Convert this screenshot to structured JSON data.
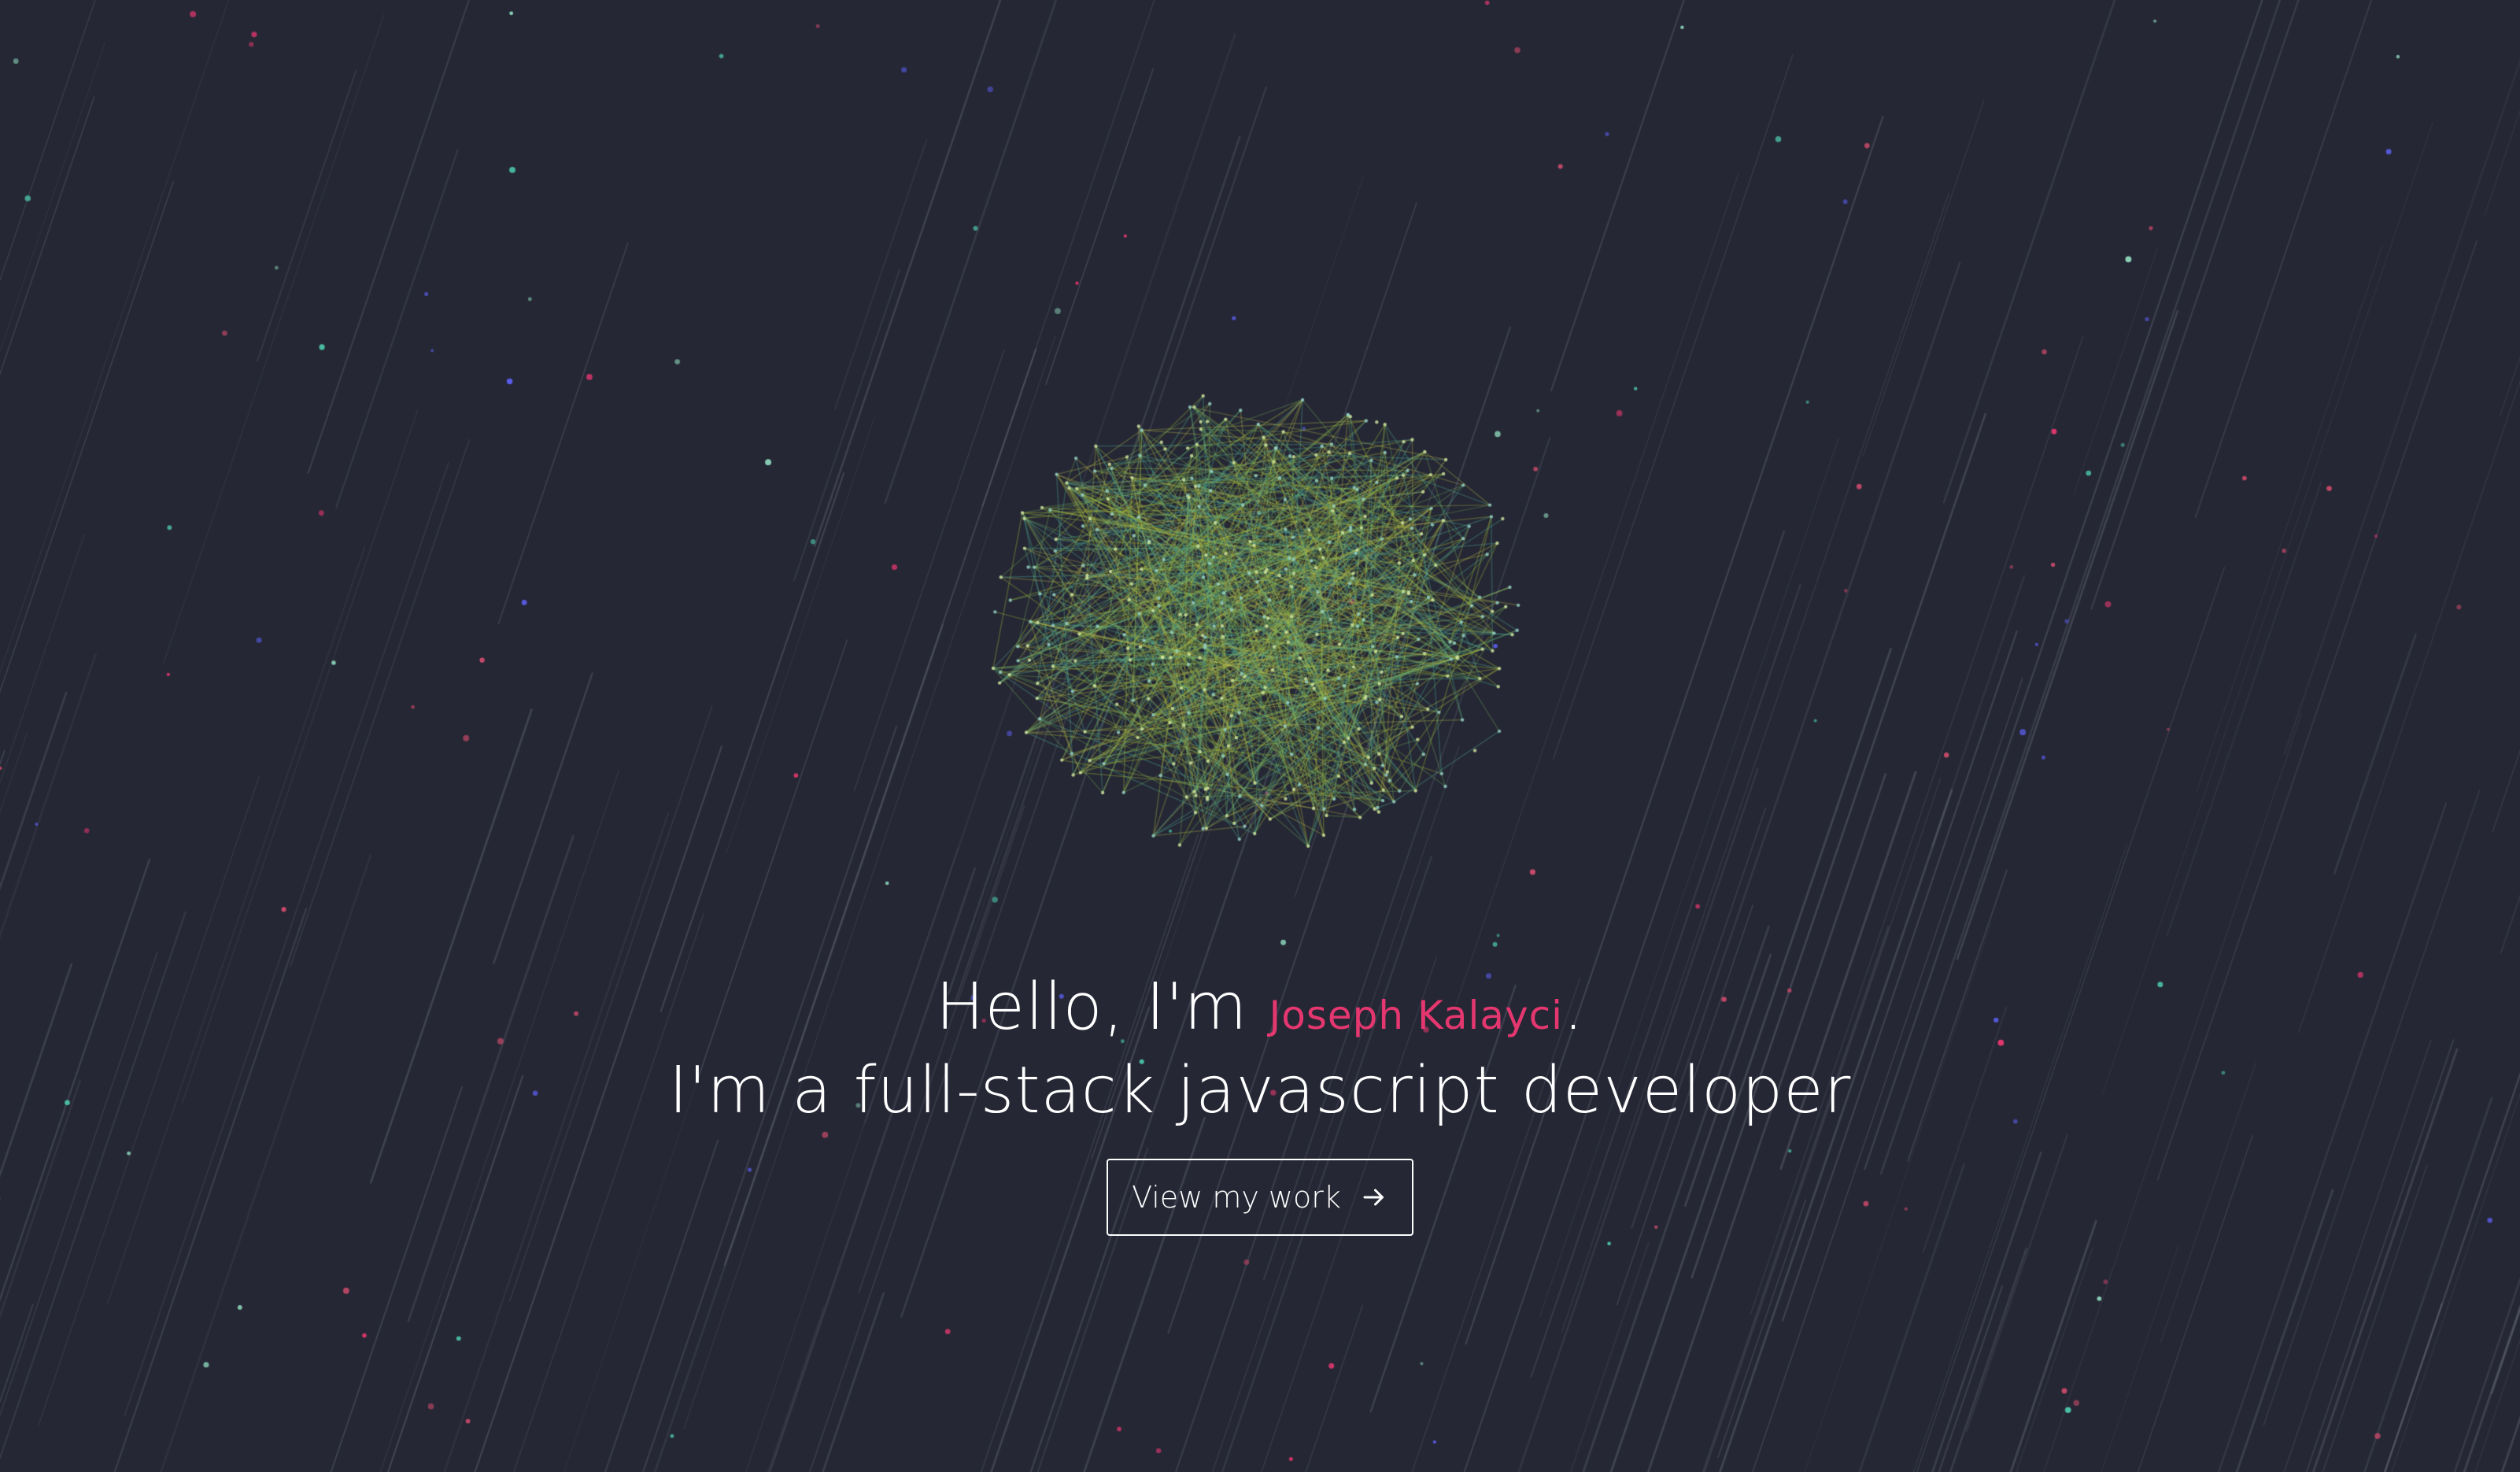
{
  "hero": {
    "greeting": "Hello, I'm",
    "name": "Joseph Kalayci",
    "name_suffix": ".",
    "tagline": "I'm a full-stack javascript developer",
    "cta_label": "View my work",
    "cta_icon": "arrow-right-icon"
  },
  "colors": {
    "background": "#252734",
    "accent": "#e4376f",
    "text": "#ffffff"
  }
}
